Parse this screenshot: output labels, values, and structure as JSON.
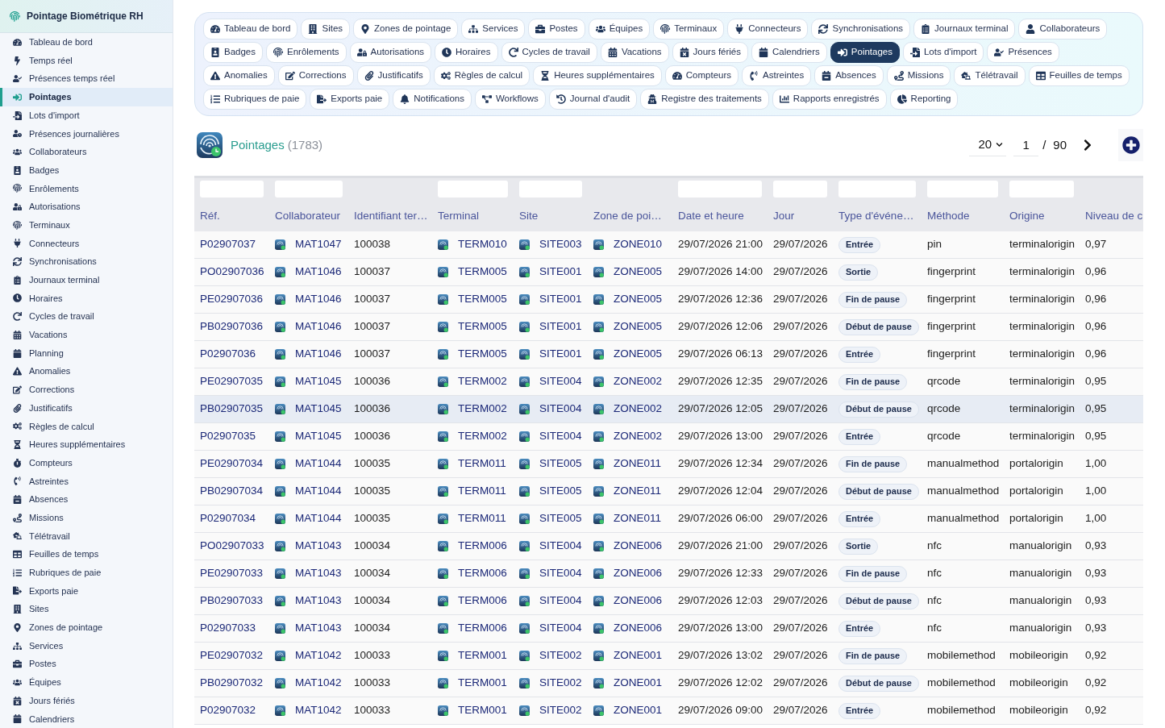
{
  "sidebar": {
    "title": "Pointage Biométrique RH",
    "items": [
      {
        "label": "Tableau de bord",
        "selected": false
      },
      {
        "label": "Temps réel",
        "selected": false
      },
      {
        "label": "Présences temps réel",
        "selected": false
      },
      {
        "label": "Pointages",
        "selected": true
      },
      {
        "label": "Lots d'import",
        "selected": false
      },
      {
        "label": "Présences journalières",
        "selected": false
      },
      {
        "label": "Collaborateurs",
        "selected": false
      },
      {
        "label": "Badges",
        "selected": false
      },
      {
        "label": "Enrôlements",
        "selected": false
      },
      {
        "label": "Autorisations",
        "selected": false
      },
      {
        "label": "Terminaux",
        "selected": false
      },
      {
        "label": "Connecteurs",
        "selected": false
      },
      {
        "label": "Synchronisations",
        "selected": false
      },
      {
        "label": "Journaux terminal",
        "selected": false
      },
      {
        "label": "Horaires",
        "selected": false
      },
      {
        "label": "Cycles de travail",
        "selected": false
      },
      {
        "label": "Vacations",
        "selected": false
      },
      {
        "label": "Planning",
        "selected": false
      },
      {
        "label": "Anomalies",
        "selected": false
      },
      {
        "label": "Corrections",
        "selected": false
      },
      {
        "label": "Justificatifs",
        "selected": false
      },
      {
        "label": "Règles de calcul",
        "selected": false
      },
      {
        "label": "Heures supplémentaires",
        "selected": false
      },
      {
        "label": "Compteurs",
        "selected": false
      },
      {
        "label": "Astreintes",
        "selected": false
      },
      {
        "label": "Absences",
        "selected": false
      },
      {
        "label": "Missions",
        "selected": false
      },
      {
        "label": "Télétravail",
        "selected": false
      },
      {
        "label": "Feuilles de temps",
        "selected": false
      },
      {
        "label": "Rubriques de paie",
        "selected": false
      },
      {
        "label": "Exports paie",
        "selected": false
      },
      {
        "label": "Sites",
        "selected": false
      },
      {
        "label": "Zones de pointage",
        "selected": false
      },
      {
        "label": "Services",
        "selected": false
      },
      {
        "label": "Postes",
        "selected": false
      },
      {
        "label": "Équipes",
        "selected": false
      },
      {
        "label": "Jours fériés",
        "selected": false
      },
      {
        "label": "Calendriers",
        "selected": false
      }
    ]
  },
  "tab_rows": [
    [
      {
        "label": "Tableau de bord",
        "selected": false
      },
      {
        "label": "Sites",
        "selected": false
      },
      {
        "label": "Zones de pointage",
        "selected": false
      },
      {
        "label": "Services",
        "selected": false
      },
      {
        "label": "Postes",
        "selected": false
      },
      {
        "label": "Équipes",
        "selected": false
      },
      {
        "label": "Terminaux",
        "selected": false
      },
      {
        "label": "Connecteurs",
        "selected": false
      },
      {
        "label": "Synchronisations",
        "selected": false
      },
      {
        "label": "Journaux terminal",
        "selected": false
      },
      {
        "label": "Collaborateurs",
        "selected": false
      }
    ],
    [
      {
        "label": "Badges",
        "selected": false
      },
      {
        "label": "Enrôlements",
        "selected": false
      },
      {
        "label": "Autorisations",
        "selected": false
      },
      {
        "label": "Horaires",
        "selected": false
      },
      {
        "label": "Cycles de travail",
        "selected": false
      },
      {
        "label": "Vacations",
        "selected": false
      },
      {
        "label": "Jours fériés",
        "selected": false
      },
      {
        "label": "Calendriers",
        "selected": false
      },
      {
        "label": "Pointages",
        "selected": true
      },
      {
        "label": "Lots d'import",
        "selected": false
      },
      {
        "label": "Présences",
        "selected": false
      }
    ],
    [
      {
        "label": "Anomalies",
        "selected": false
      },
      {
        "label": "Corrections",
        "selected": false
      },
      {
        "label": "Justificatifs",
        "selected": false
      },
      {
        "label": "Règles de calcul",
        "selected": false
      },
      {
        "label": "Heures supplémentaires",
        "selected": false
      },
      {
        "label": "Compteurs",
        "selected": false
      },
      {
        "label": "Astreintes",
        "selected": false
      },
      {
        "label": "Absences",
        "selected": false
      },
      {
        "label": "Missions",
        "selected": false
      },
      {
        "label": "Télétravail",
        "selected": false
      },
      {
        "label": "Feuilles de temps",
        "selected": false
      }
    ],
    [
      {
        "label": "Rubriques de paie",
        "selected": false
      },
      {
        "label": "Exports paie",
        "selected": false
      },
      {
        "label": "Notifications",
        "selected": false
      },
      {
        "label": "Workflows",
        "selected": false
      },
      {
        "label": "Journal d'audit",
        "selected": false
      },
      {
        "label": "Registre des traitements",
        "selected": false
      },
      {
        "label": "Rapports enregistrés",
        "selected": false
      },
      {
        "label": "Reporting",
        "selected": false
      }
    ]
  ],
  "page_header": {
    "title": "Pointages",
    "count": "(1783)"
  },
  "pagination": {
    "page_size": "20",
    "page": "1",
    "separator": "/",
    "total_pages": "90"
  },
  "table": {
    "columns": [
      {
        "label": "Réf.",
        "has_filter": true
      },
      {
        "label": "Collaborateur",
        "has_filter": true
      },
      {
        "label": "Identifiant ter…",
        "has_filter": false
      },
      {
        "label": "Terminal",
        "has_filter": true
      },
      {
        "label": "Site",
        "has_filter": true
      },
      {
        "label": "Zone de poi…",
        "has_filter": false
      },
      {
        "label": "Date et heure",
        "has_filter": true
      },
      {
        "label": "Jour",
        "has_filter": true
      },
      {
        "label": "Type d'événe…",
        "has_filter": true
      },
      {
        "label": "Méthode",
        "has_filter": true
      },
      {
        "label": "Origine",
        "has_filter": true
      },
      {
        "label": "Niveau de c",
        "has_filter": false
      }
    ],
    "rows": [
      {
        "ref": "P02907037",
        "employee": "MAT1047",
        "terminal_id": "100038",
        "terminal": "TERM010",
        "site": "SITE003",
        "zone": "ZONE010",
        "datetime": "29/07/2026 21:00",
        "day": "29/07/2026",
        "event_type": "Entrée",
        "method": "pin",
        "origin": "terminalorigin",
        "confidence": "0,97",
        "selected": false
      },
      {
        "ref": "PO02907036",
        "employee": "MAT1046",
        "terminal_id": "100037",
        "terminal": "TERM005",
        "site": "SITE001",
        "zone": "ZONE005",
        "datetime": "29/07/2026 14:00",
        "day": "29/07/2026",
        "event_type": "Sortie",
        "method": "fingerprint",
        "origin": "terminalorigin",
        "confidence": "0,96",
        "selected": false
      },
      {
        "ref": "PE02907036",
        "employee": "MAT1046",
        "terminal_id": "100037",
        "terminal": "TERM005",
        "site": "SITE001",
        "zone": "ZONE005",
        "datetime": "29/07/2026 12:36",
        "day": "29/07/2026",
        "event_type": "Fin de pause",
        "method": "fingerprint",
        "origin": "terminalorigin",
        "confidence": "0,96",
        "selected": false
      },
      {
        "ref": "PB02907036",
        "employee": "MAT1046",
        "terminal_id": "100037",
        "terminal": "TERM005",
        "site": "SITE001",
        "zone": "ZONE005",
        "datetime": "29/07/2026 12:06",
        "day": "29/07/2026",
        "event_type": "Début de pause",
        "method": "fingerprint",
        "origin": "terminalorigin",
        "confidence": "0,96",
        "selected": false
      },
      {
        "ref": "P02907036",
        "employee": "MAT1046",
        "terminal_id": "100037",
        "terminal": "TERM005",
        "site": "SITE001",
        "zone": "ZONE005",
        "datetime": "29/07/2026 06:13",
        "day": "29/07/2026",
        "event_type": "Entrée",
        "method": "fingerprint",
        "origin": "terminalorigin",
        "confidence": "0,96",
        "selected": false
      },
      {
        "ref": "PE02907035",
        "employee": "MAT1045",
        "terminal_id": "100036",
        "terminal": "TERM002",
        "site": "SITE004",
        "zone": "ZONE002",
        "datetime": "29/07/2026 12:35",
        "day": "29/07/2026",
        "event_type": "Fin de pause",
        "method": "qrcode",
        "origin": "terminalorigin",
        "confidence": "0,95",
        "selected": false
      },
      {
        "ref": "PB02907035",
        "employee": "MAT1045",
        "terminal_id": "100036",
        "terminal": "TERM002",
        "site": "SITE004",
        "zone": "ZONE002",
        "datetime": "29/07/2026 12:05",
        "day": "29/07/2026",
        "event_type": "Début de pause",
        "method": "qrcode",
        "origin": "terminalorigin",
        "confidence": "0,95",
        "selected": true
      },
      {
        "ref": "P02907035",
        "employee": "MAT1045",
        "terminal_id": "100036",
        "terminal": "TERM002",
        "site": "SITE004",
        "zone": "ZONE002",
        "datetime": "29/07/2026 13:00",
        "day": "29/07/2026",
        "event_type": "Entrée",
        "method": "qrcode",
        "origin": "terminalorigin",
        "confidence": "0,95",
        "selected": false
      },
      {
        "ref": "PE02907034",
        "employee": "MAT1044",
        "terminal_id": "100035",
        "terminal": "TERM011",
        "site": "SITE005",
        "zone": "ZONE011",
        "datetime": "29/07/2026 12:34",
        "day": "29/07/2026",
        "event_type": "Fin de pause",
        "method": "manualmethod",
        "origin": "portalorigin",
        "confidence": "1,00",
        "selected": false
      },
      {
        "ref": "PB02907034",
        "employee": "MAT1044",
        "terminal_id": "100035",
        "terminal": "TERM011",
        "site": "SITE005",
        "zone": "ZONE011",
        "datetime": "29/07/2026 12:04",
        "day": "29/07/2026",
        "event_type": "Début de pause",
        "method": "manualmethod",
        "origin": "portalorigin",
        "confidence": "1,00",
        "selected": false
      },
      {
        "ref": "P02907034",
        "employee": "MAT1044",
        "terminal_id": "100035",
        "terminal": "TERM011",
        "site": "SITE005",
        "zone": "ZONE011",
        "datetime": "29/07/2026 06:00",
        "day": "29/07/2026",
        "event_type": "Entrée",
        "method": "manualmethod",
        "origin": "portalorigin",
        "confidence": "1,00",
        "selected": false
      },
      {
        "ref": "PO02907033",
        "employee": "MAT1043",
        "terminal_id": "100034",
        "terminal": "TERM006",
        "site": "SITE004",
        "zone": "ZONE006",
        "datetime": "29/07/2026 21:00",
        "day": "29/07/2026",
        "event_type": "Sortie",
        "method": "nfc",
        "origin": "manualorigin",
        "confidence": "0,93",
        "selected": false
      },
      {
        "ref": "PE02907033",
        "employee": "MAT1043",
        "terminal_id": "100034",
        "terminal": "TERM006",
        "site": "SITE004",
        "zone": "ZONE006",
        "datetime": "29/07/2026 12:33",
        "day": "29/07/2026",
        "event_type": "Fin de pause",
        "method": "nfc",
        "origin": "manualorigin",
        "confidence": "0,93",
        "selected": false
      },
      {
        "ref": "PB02907033",
        "employee": "MAT1043",
        "terminal_id": "100034",
        "terminal": "TERM006",
        "site": "SITE004",
        "zone": "ZONE006",
        "datetime": "29/07/2026 12:03",
        "day": "29/07/2026",
        "event_type": "Début de pause",
        "method": "nfc",
        "origin": "manualorigin",
        "confidence": "0,93",
        "selected": false
      },
      {
        "ref": "P02907033",
        "employee": "MAT1043",
        "terminal_id": "100034",
        "terminal": "TERM006",
        "site": "SITE004",
        "zone": "ZONE006",
        "datetime": "29/07/2026 13:00",
        "day": "29/07/2026",
        "event_type": "Entrée",
        "method": "nfc",
        "origin": "manualorigin",
        "confidence": "0,93",
        "selected": false
      },
      {
        "ref": "PE02907032",
        "employee": "MAT1042",
        "terminal_id": "100033",
        "terminal": "TERM001",
        "site": "SITE002",
        "zone": "ZONE001",
        "datetime": "29/07/2026 13:02",
        "day": "29/07/2026",
        "event_type": "Fin de pause",
        "method": "mobilemethod",
        "origin": "mobileorigin",
        "confidence": "0,92",
        "selected": false
      },
      {
        "ref": "PB02907032",
        "employee": "MAT1042",
        "terminal_id": "100033",
        "terminal": "TERM001",
        "site": "SITE002",
        "zone": "ZONE001",
        "datetime": "29/07/2026 12:02",
        "day": "29/07/2026",
        "event_type": "Début de pause",
        "method": "mobilemethod",
        "origin": "mobileorigin",
        "confidence": "0,92",
        "selected": false
      },
      {
        "ref": "P02907032",
        "employee": "MAT1042",
        "terminal_id": "100033",
        "terminal": "TERM001",
        "site": "SITE002",
        "zone": "ZONE001",
        "datetime": "29/07/2026 09:00",
        "day": "29/07/2026",
        "event_type": "Entrée",
        "method": "mobilemethod",
        "origin": "mobileorigin",
        "confidence": "0,92",
        "selected": false
      }
    ]
  }
}
